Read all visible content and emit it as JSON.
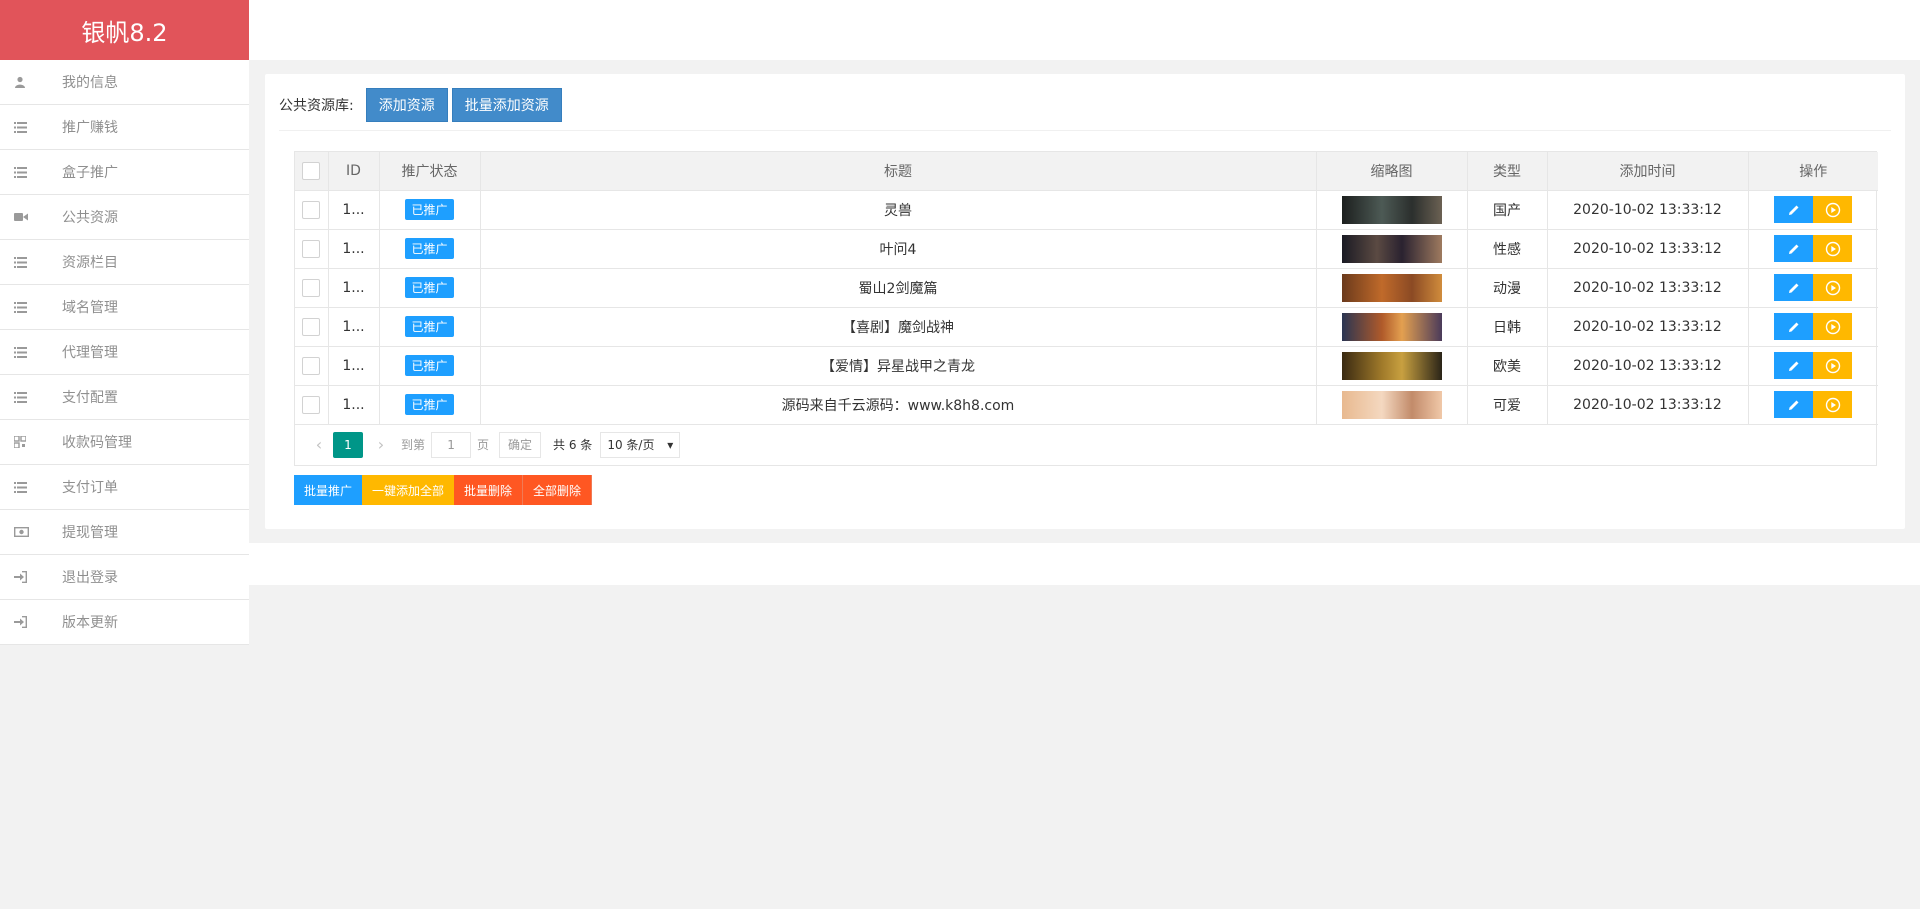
{
  "brand": {
    "title": "银帆8.2"
  },
  "sidebar": {
    "items": [
      {
        "label": "我的信息",
        "icon": "user-icon"
      },
      {
        "label": "推广赚钱",
        "icon": "list-icon"
      },
      {
        "label": "盒子推广",
        "icon": "list-icon"
      },
      {
        "label": "公共资源",
        "icon": "video-camera-icon"
      },
      {
        "label": "资源栏目",
        "icon": "list-icon"
      },
      {
        "label": "域名管理",
        "icon": "list-icon"
      },
      {
        "label": "代理管理",
        "icon": "list-icon"
      },
      {
        "label": "支付配置",
        "icon": "list-icon"
      },
      {
        "label": "收款码管理",
        "icon": "qrcode-icon"
      },
      {
        "label": "支付订单",
        "icon": "list-icon"
      },
      {
        "label": "提现管理",
        "icon": "money-icon"
      },
      {
        "label": "退出登录",
        "icon": "sign-in-icon"
      },
      {
        "label": "版本更新",
        "icon": "sign-in-icon"
      }
    ]
  },
  "toolbar": {
    "label": "公共资源库:",
    "add_label": "添加资源",
    "batch_add_label": "批量添加资源"
  },
  "table": {
    "headers": [
      "ID",
      "推广状态",
      "标题",
      "缩略图",
      "类型",
      "添加时间",
      "操作"
    ],
    "rows": [
      {
        "id": "1...",
        "status": "已推广",
        "title": "灵兽",
        "type": "国产",
        "time": "2020-10-02 13:33:12"
      },
      {
        "id": "1...",
        "status": "已推广",
        "title": "叶问4",
        "type": "性感",
        "time": "2020-10-02 13:33:12"
      },
      {
        "id": "1...",
        "status": "已推广",
        "title": "蜀山2剑魔篇",
        "type": "动漫",
        "time": "2020-10-02 13:33:12"
      },
      {
        "id": "1...",
        "status": "已推广",
        "title": "【喜剧】魔剑战神",
        "type": "日韩",
        "time": "2020-10-02 13:33:12"
      },
      {
        "id": "1...",
        "status": "已推广",
        "title": "【爱情】异星战甲之青龙",
        "type": "欧美",
        "time": "2020-10-02 13:33:12"
      },
      {
        "id": "1...",
        "status": "已推广",
        "title": "源码来自千云源码：www.k8h8.com",
        "type": "可爱",
        "time": "2020-10-02 13:33:12"
      }
    ]
  },
  "pager": {
    "current": "1",
    "goto_label": "到第",
    "page_input": "1",
    "page_unit": "页",
    "confirm": "确定",
    "total": "共 6 条",
    "per_page": "10 条/页"
  },
  "actions": {
    "batch_promote": "批量推广",
    "add_all": "一键添加全部",
    "batch_delete": "批量删除",
    "delete_all": "全部删除"
  },
  "colors": {
    "brand": "#e1545a",
    "primary": "#1e9fff",
    "warn": "#ffb800",
    "danger": "#ff5722",
    "pager_active": "#009688",
    "toolbar_btn": "#428bca"
  }
}
